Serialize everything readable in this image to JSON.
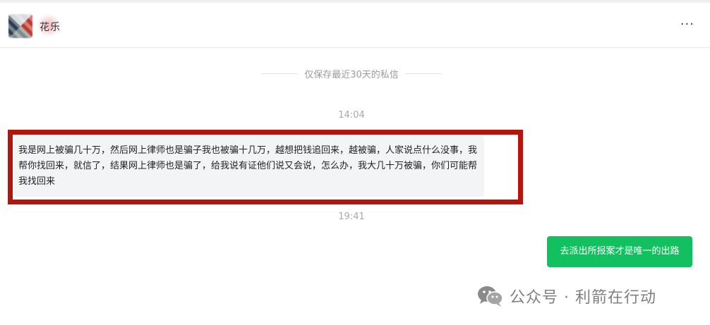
{
  "header": {
    "contact_name": "花乐",
    "more_glyph": "···"
  },
  "chat": {
    "retention_notice": "仅保存最近30天的私信",
    "timestamps": [
      "14:04",
      "19:41"
    ],
    "incoming_message": "我是网上被骗几十万，然后网上律师也是骗子我也被骗十几万，越想把钱追回来，越被骗，人家说点什么没事，我帮你找回来，就信了，结果网上律师也是骗了，给我说有证他们说又会说，怎么办，我大几十万被骗，你们可能帮我找回来",
    "outgoing_message": "去派出所报案才是唯一的出路"
  },
  "watermark": {
    "text": "公众号 · 利箭在行动"
  },
  "colors": {
    "outgoing_bubble": "#12c060",
    "incoming_bubble": "#f3f4f6",
    "highlight_border": "#b4140c"
  },
  "icons": [
    "avatar-image",
    "more-options-icon",
    "wechat-logo-icon"
  ]
}
